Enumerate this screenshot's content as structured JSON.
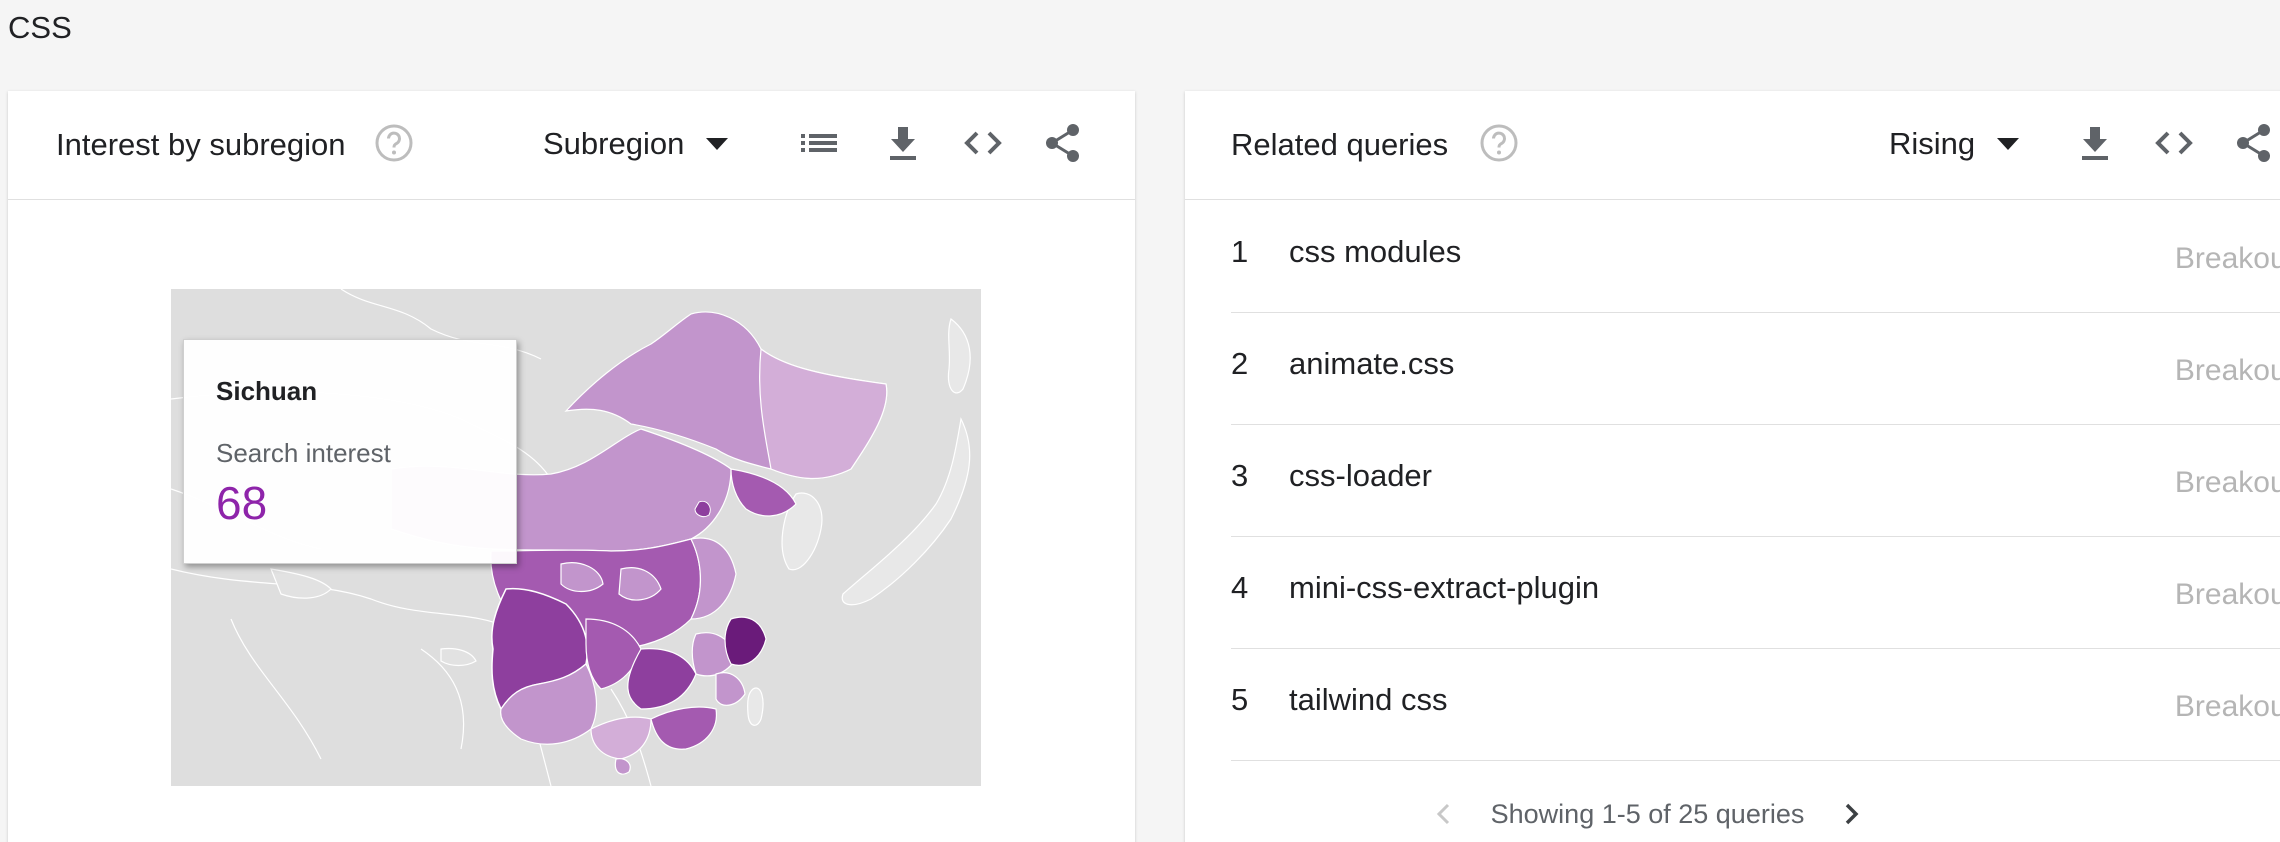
{
  "page": {
    "title": "CSS"
  },
  "subregion_card": {
    "title": "Interest by subregion",
    "dropdown_value": "Subregion",
    "icons": [
      "help-icon",
      "list-icon",
      "download-icon",
      "embed-code-icon",
      "share-icon"
    ],
    "tooltip": {
      "region": "Sichuan",
      "label": "Search interest",
      "value": "68"
    },
    "map_colors": {
      "land": "#dedede",
      "light": "#d3aed8",
      "mid": "#c295cc",
      "dark": "#a45ab0",
      "darker": "#8e3f9e",
      "darkest": "#6a1b7a",
      "border": "#ffffff"
    }
  },
  "queries_card": {
    "title": "Related queries",
    "dropdown_value": "Rising",
    "icons": [
      "help-icon",
      "download-icon",
      "embed-code-icon",
      "share-icon"
    ],
    "rows": [
      {
        "rank": "1",
        "query": "css modules",
        "value": "Breakout"
      },
      {
        "rank": "2",
        "query": "animate.css",
        "value": "Breakout"
      },
      {
        "rank": "3",
        "query": "css-loader",
        "value": "Breakout"
      },
      {
        "rank": "4",
        "query": "mini-css-extract-plugin",
        "value": "Breakout"
      },
      {
        "rank": "5",
        "query": "tailwind css",
        "value": "Breakout"
      }
    ],
    "pagination": "Showing 1-5 of 25 queries"
  }
}
